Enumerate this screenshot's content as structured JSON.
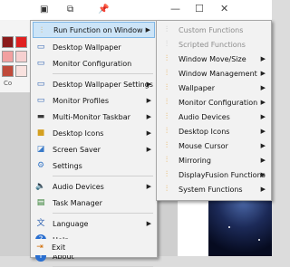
{
  "main_menu": {
    "items": [
      {
        "label": "Run Function on Window",
        "icon": "sliders-icon",
        "submenu": true,
        "highlight": true
      },
      {
        "label": "Desktop Wallpaper",
        "icon": "monitor-icon",
        "submenu": false
      },
      {
        "label": "Monitor Configuration",
        "icon": "monitor-icon",
        "submenu": false
      },
      {
        "label": "Desktop Wallpaper Settings",
        "icon": "monitor-icon",
        "submenu": true
      },
      {
        "label": "Monitor Profiles",
        "icon": "monitor-icon",
        "submenu": true
      },
      {
        "label": "Multi-Monitor Taskbar",
        "icon": "taskbar-icon",
        "submenu": true
      },
      {
        "label": "Desktop Icons",
        "icon": "folder-icon",
        "submenu": true
      },
      {
        "label": "Screen Saver",
        "icon": "screensaver-icon",
        "submenu": true
      },
      {
        "label": "Settings",
        "icon": "gear-icon",
        "submenu": false
      },
      {
        "label": "Audio Devices",
        "icon": "speaker-icon",
        "submenu": true
      },
      {
        "label": "Task Manager",
        "icon": "task-manager-icon",
        "submenu": false
      },
      {
        "label": "Language",
        "icon": "language-icon",
        "submenu": true
      },
      {
        "label": "Help",
        "icon": "help-icon",
        "submenu": false
      },
      {
        "label": "About",
        "icon": "info-icon",
        "submenu": false
      },
      {
        "label": "Exit",
        "icon": "exit-icon",
        "submenu": false
      }
    ]
  },
  "sub_menu": {
    "items": [
      {
        "label": "Custom Functions",
        "disabled": true,
        "submenu": false
      },
      {
        "label": "Scripted Functions",
        "disabled": true,
        "submenu": false
      },
      {
        "label": "Window Move/Size",
        "disabled": false,
        "submenu": true
      },
      {
        "label": "Window Management",
        "disabled": false,
        "submenu": true
      },
      {
        "label": "Wallpaper",
        "disabled": false,
        "submenu": true
      },
      {
        "label": "Monitor Configuration",
        "disabled": false,
        "submenu": true
      },
      {
        "label": "Audio Devices",
        "disabled": false,
        "submenu": true
      },
      {
        "label": "Desktop Icons",
        "disabled": false,
        "submenu": true
      },
      {
        "label": "Mouse Cursor",
        "disabled": false,
        "submenu": true
      },
      {
        "label": "Mirroring",
        "disabled": false,
        "submenu": true
      },
      {
        "label": "DisplayFusion Functions",
        "disabled": false,
        "submenu": true
      },
      {
        "label": "System Functions",
        "disabled": false,
        "submenu": true
      }
    ]
  },
  "background_app": {
    "caption": "Co",
    "swatch_colors": [
      "#8b1a1a",
      "#e02020",
      "#f2a0a0",
      "#f6d0d0",
      "#c04a3a",
      "#f9e2df"
    ]
  },
  "colors": {
    "highlight_bg": "#cce4f7",
    "highlight_border": "#7fb7e6",
    "menu_bg": "#f2f2f2",
    "disabled_text": "#8c8c8c"
  }
}
